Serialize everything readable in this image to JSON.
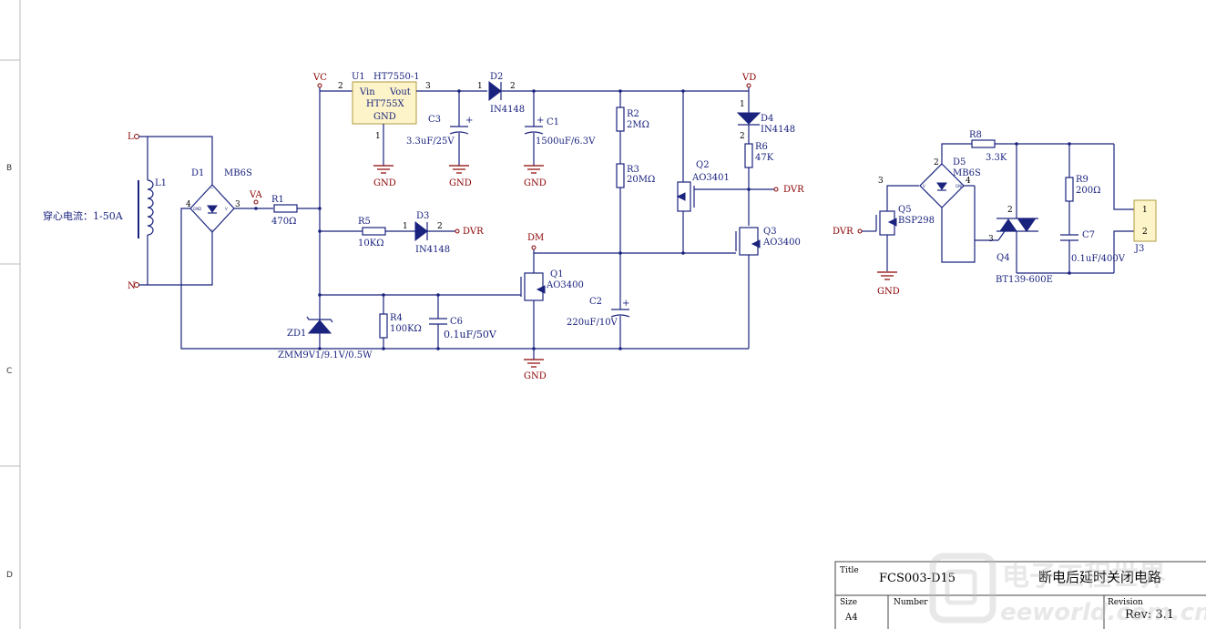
{
  "zones": [
    "B",
    "C",
    "D"
  ],
  "labels": {
    "L": "L",
    "N": "N",
    "L1": "L1",
    "coil_note": "穿心电流：1-50A",
    "D1": "D1",
    "D1v": "MB6S",
    "VA": "VA",
    "R1": "R1",
    "R1v": "470Ω",
    "VC": "VC",
    "U1": "U1",
    "U1v": "HT7550-1",
    "u_vin": "Vin",
    "u_vout": "Vout",
    "u_mid": "HT755X",
    "u_gnd": "GND",
    "C3": "C3",
    "C3v": "3.3uF/25V",
    "D2": "D2",
    "D2v": "IN4148",
    "C1": "C1",
    "C1v": "1500uF/6.3V",
    "R2": "R2",
    "R2v": "2MΩ",
    "R3": "R3",
    "R3v": "20MΩ",
    "VD": "VD",
    "D4": "D4",
    "D4v": "IN4148",
    "R6": "R6",
    "R6v": "47K",
    "Q2": "Q2",
    "Q2v": "AO3401",
    "DVR": "DVR",
    "R5": "R5",
    "R5v": "10KΩ",
    "D3": "D3",
    "D3v": "IN4148",
    "DM": "DM",
    "Q3": "Q3",
    "Q3v": "AO3400",
    "Q1": "Q1",
    "Q1v": "AO3400",
    "C2": "C2",
    "C2v": "220uF/10V",
    "R4": "R4",
    "R4v": "100KΩ",
    "C6": "C6",
    "C6v": "0.1uF/50V",
    "ZD1": "ZD1",
    "ZD1v": "ZMM9V1/9.1V/0.5W",
    "GND": "GND",
    "R8": "R8",
    "R8v": "3.3K",
    "D5": "D5",
    "D5v": "MB6S",
    "Q5": "Q5",
    "Q5v": "BSP298",
    "R9": "R9",
    "R9v": "200Ω",
    "C7": "C7",
    "C7v": "0.1uF/400V",
    "Q4": "Q4",
    "Q4v": "BT139-600E",
    "J3": "J3",
    "gnd_small": "GND"
  },
  "pins": {
    "p1": "1",
    "p2": "2",
    "p3": "3",
    "p4": "4"
  },
  "title_block": {
    "title_label": "Title",
    "title_value": "FCS003-D15",
    "title_cn": "断电后延时关闭电路",
    "size_label": "Size",
    "size_value": "A4",
    "number_label": "Number",
    "revision_label": "Revision",
    "rev_value": "Rev:  3.1"
  },
  "watermark": {
    "cn": "电子工程世界",
    "en": "eeworld.com.cn"
  },
  "colors": {
    "wire": "#1a237e",
    "net": "#8b0000",
    "ic_fill": "#fdf5c9"
  }
}
